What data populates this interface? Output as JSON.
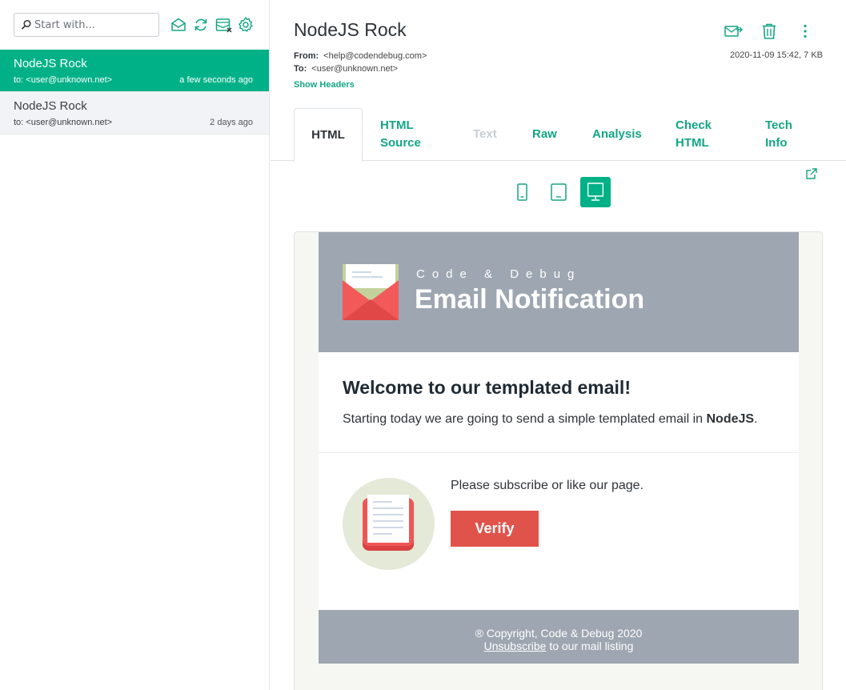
{
  "sidebar": {
    "search": {
      "placeholder": "Start with..."
    },
    "toolbar_icons": [
      "mail-open-icon",
      "refresh-icon",
      "mailbox-clear-icon",
      "gear-icon"
    ],
    "messages": [
      {
        "subject": "NodeJS Rock",
        "to": "to: <user@unknown.net>",
        "time": "a few seconds ago",
        "active": true
      },
      {
        "subject": "NodeJS Rock",
        "to": "to: <user@unknown.net>",
        "time": "2 days ago",
        "active": false
      }
    ]
  },
  "message": {
    "title": "NodeJS Rock",
    "from_label": "From:",
    "from": "<help@codendebug.com>",
    "to_label": "To:",
    "to": "<user@unknown.net>",
    "date_size": "2020-11-09 15:42, 7 KB",
    "show_headers": "Show Headers",
    "actions": [
      "forward-icon",
      "trash-icon",
      "more-vertical-icon"
    ]
  },
  "tabs": [
    {
      "label": "HTML",
      "state": "active"
    },
    {
      "label_line1": "HTML",
      "label_line2": "Source",
      "state": "normal"
    },
    {
      "label": "Text",
      "state": "disabled"
    },
    {
      "label": "Raw",
      "state": "normal"
    },
    {
      "label": "Analysis",
      "state": "normal"
    },
    {
      "label_line1": "Check",
      "label_line2": "HTML",
      "state": "normal"
    },
    {
      "label_line1": "Tech",
      "label_line2": "Info",
      "state": "normal"
    }
  ],
  "view_modes": [
    "phone-icon",
    "tablet-icon",
    "desktop-icon"
  ],
  "active_view": "desktop",
  "email": {
    "brand": "Code & Debug",
    "header_title": "Email Notification",
    "heading": "Welcome to our templated email!",
    "intro_before": "Starting today we are going to send a simple templated email in ",
    "intro_bold": "NodeJS",
    "intro_after": ".",
    "subscribe_text": "Please subscribe or like our page.",
    "verify_label": "Verify",
    "footer_copyright": "® Copyright, Code & Debug 2020",
    "footer_unsubscribe": "Unsubscribe",
    "footer_rest": " to our mail listing"
  },
  "colors": {
    "accent": "#00b188",
    "header_bg": "#9ea6b1",
    "verify_bg": "#e0534a"
  }
}
